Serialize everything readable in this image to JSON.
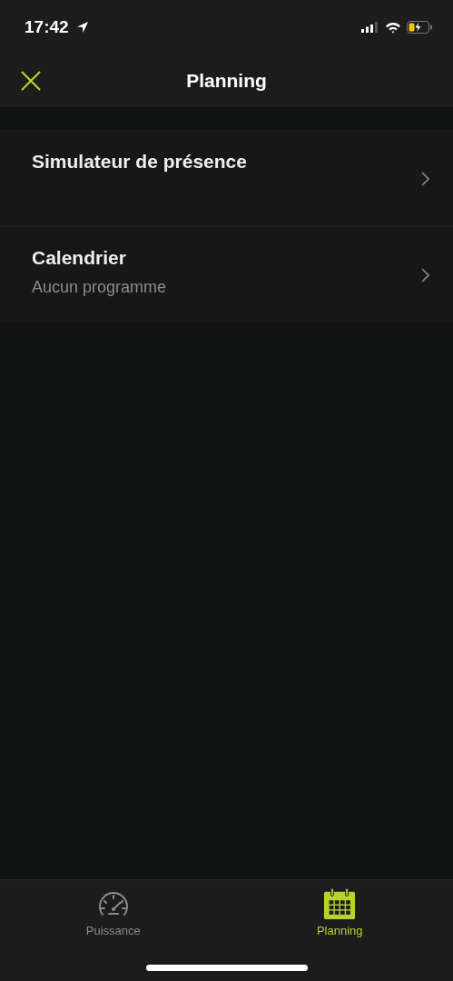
{
  "status_bar": {
    "time": "17:42"
  },
  "nav_bar": {
    "title": "Planning"
  },
  "items": [
    {
      "title": "Simulateur de présence"
    },
    {
      "title": "Calendrier",
      "subtitle": "Aucun programme"
    }
  ],
  "tab_bar": [
    {
      "label": "Puissance",
      "kind": "gauge",
      "selected": false
    },
    {
      "label": "Planning",
      "kind": "calendar",
      "selected": true
    }
  ]
}
